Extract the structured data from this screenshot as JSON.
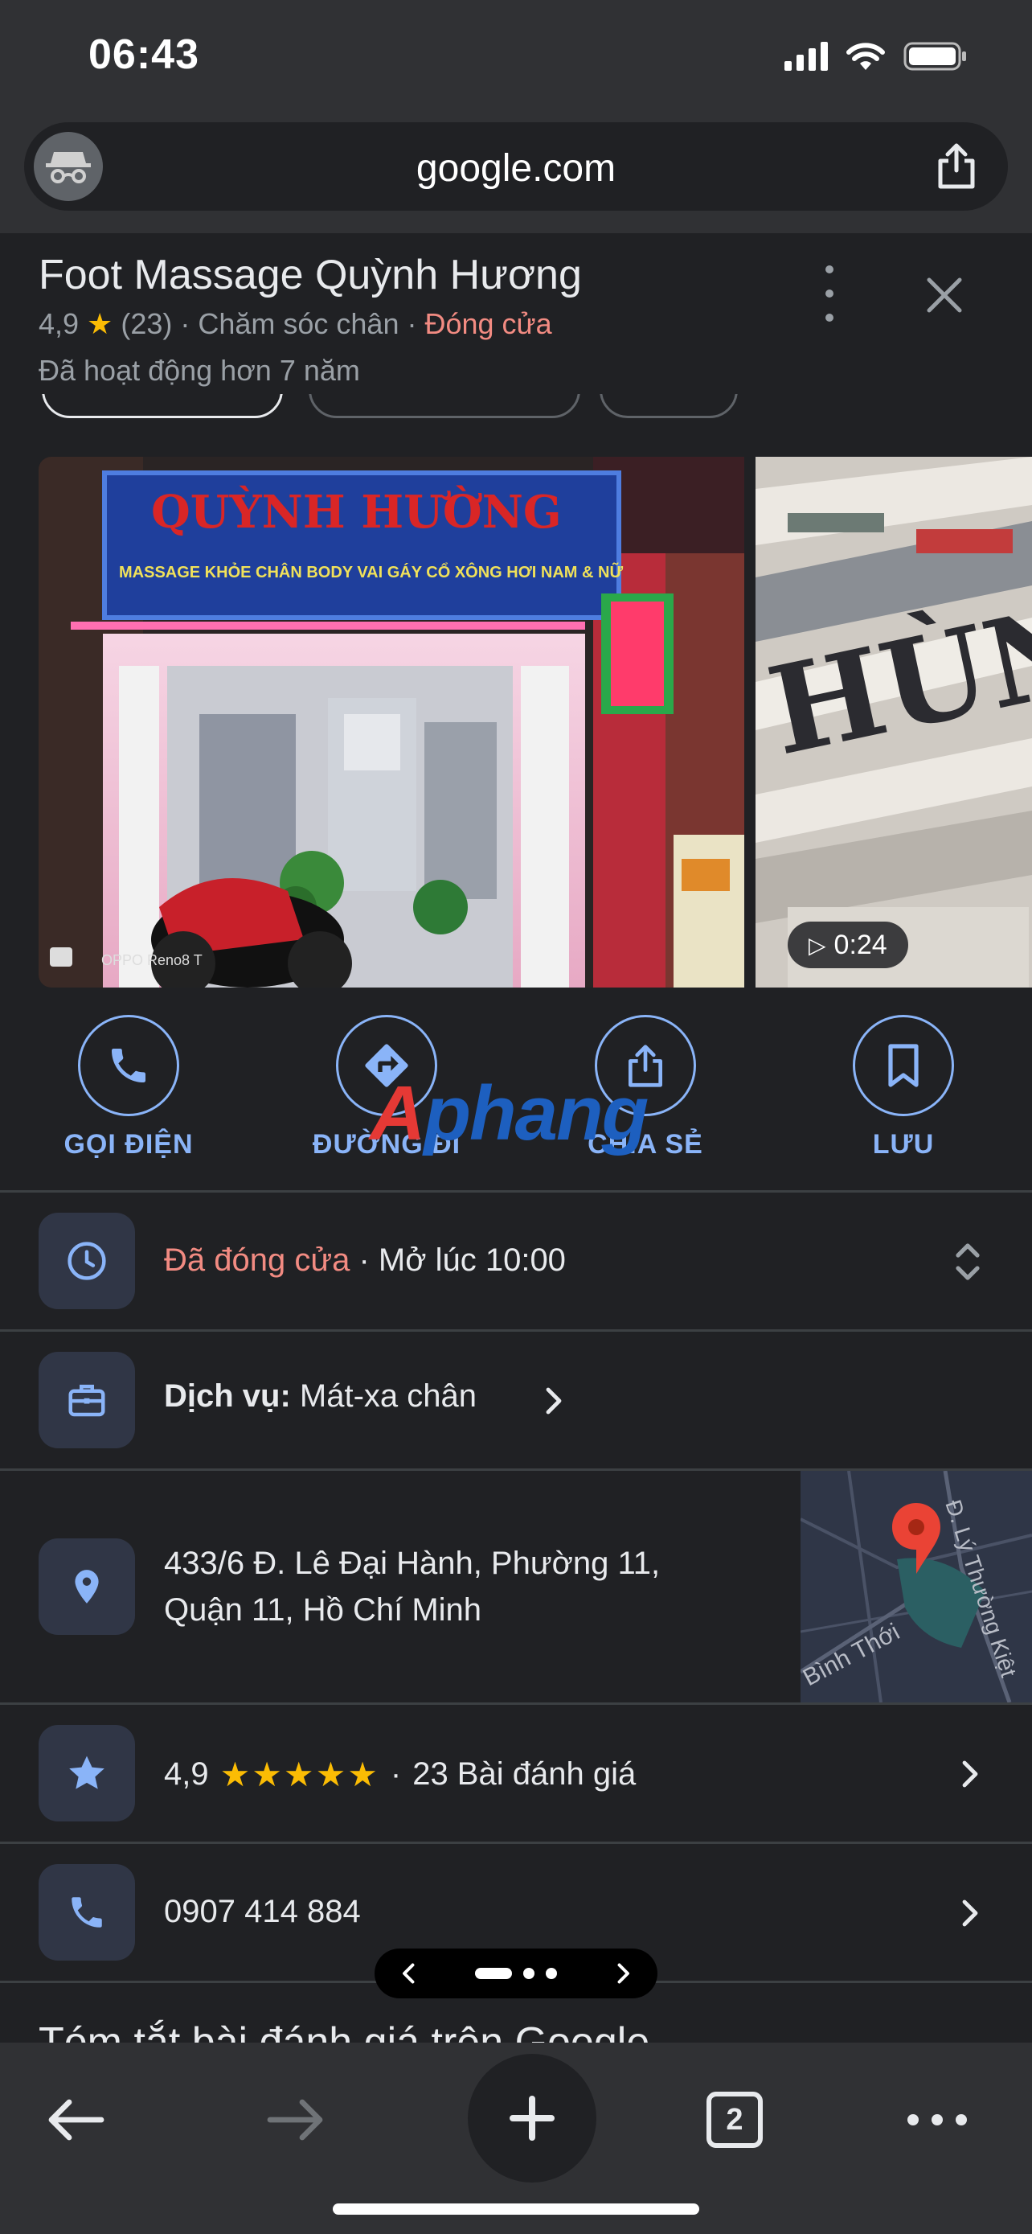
{
  "status_bar": {
    "time": "06:43"
  },
  "browser": {
    "url": "google.com",
    "tab_count": "2"
  },
  "place": {
    "name": "Foot Massage Quỳnh Hương",
    "rating": "4,9",
    "review_count_paren": "(23)",
    "category": "Chăm sóc chân",
    "open_state": "Đóng cửa",
    "since": "Đã hoạt động hơn 7 năm"
  },
  "photos": {
    "sign_title": "QUỲNH HƯỜNG",
    "sign_subtitle": "MASSAGE KHỎE CHÂN BODY VAI GÁY CỔ XÔNG HƠI NAM & NỮ",
    "camera_tag": "OPPO Reno8 T",
    "video_duration": "0:24"
  },
  "actions": [
    {
      "label": "GỌI ĐIỆN",
      "icon": "phone-icon"
    },
    {
      "label": "ĐƯỜNG ĐI",
      "icon": "directions-icon"
    },
    {
      "label": "CHIA SẺ",
      "icon": "share-icon"
    },
    {
      "label": "LƯU",
      "icon": "bookmark-icon"
    }
  ],
  "watermark": {
    "part1": "A",
    "part2": "phang"
  },
  "hours": {
    "status": "Đã đóng cửa",
    "separator": " · ",
    "opens": "Mở lúc 10:00"
  },
  "services": {
    "label": "Dịch vụ:",
    "value": "Mát-xa chân"
  },
  "address": {
    "line1": "433/6 Đ. Lê Đại Hành, Phường 11,",
    "line2": "Quận 11, Hồ Chí Minh"
  },
  "map": {
    "street1": "Bình Thới",
    "street2": "Đ. Lý Thường Kiệt"
  },
  "reviews": {
    "rating": "4,9",
    "stars": "★★★★★",
    "separator": "·",
    "count": "23 Bài đánh giá"
  },
  "phone": {
    "number": "0907 414 884"
  },
  "next_section": {
    "title": "Tóm tắt bài đánh giá trên Google"
  },
  "colors": {
    "accent": "#8ab4f8",
    "closed": "#f28b82",
    "star": "#fbbc04",
    "background": "#202124"
  }
}
